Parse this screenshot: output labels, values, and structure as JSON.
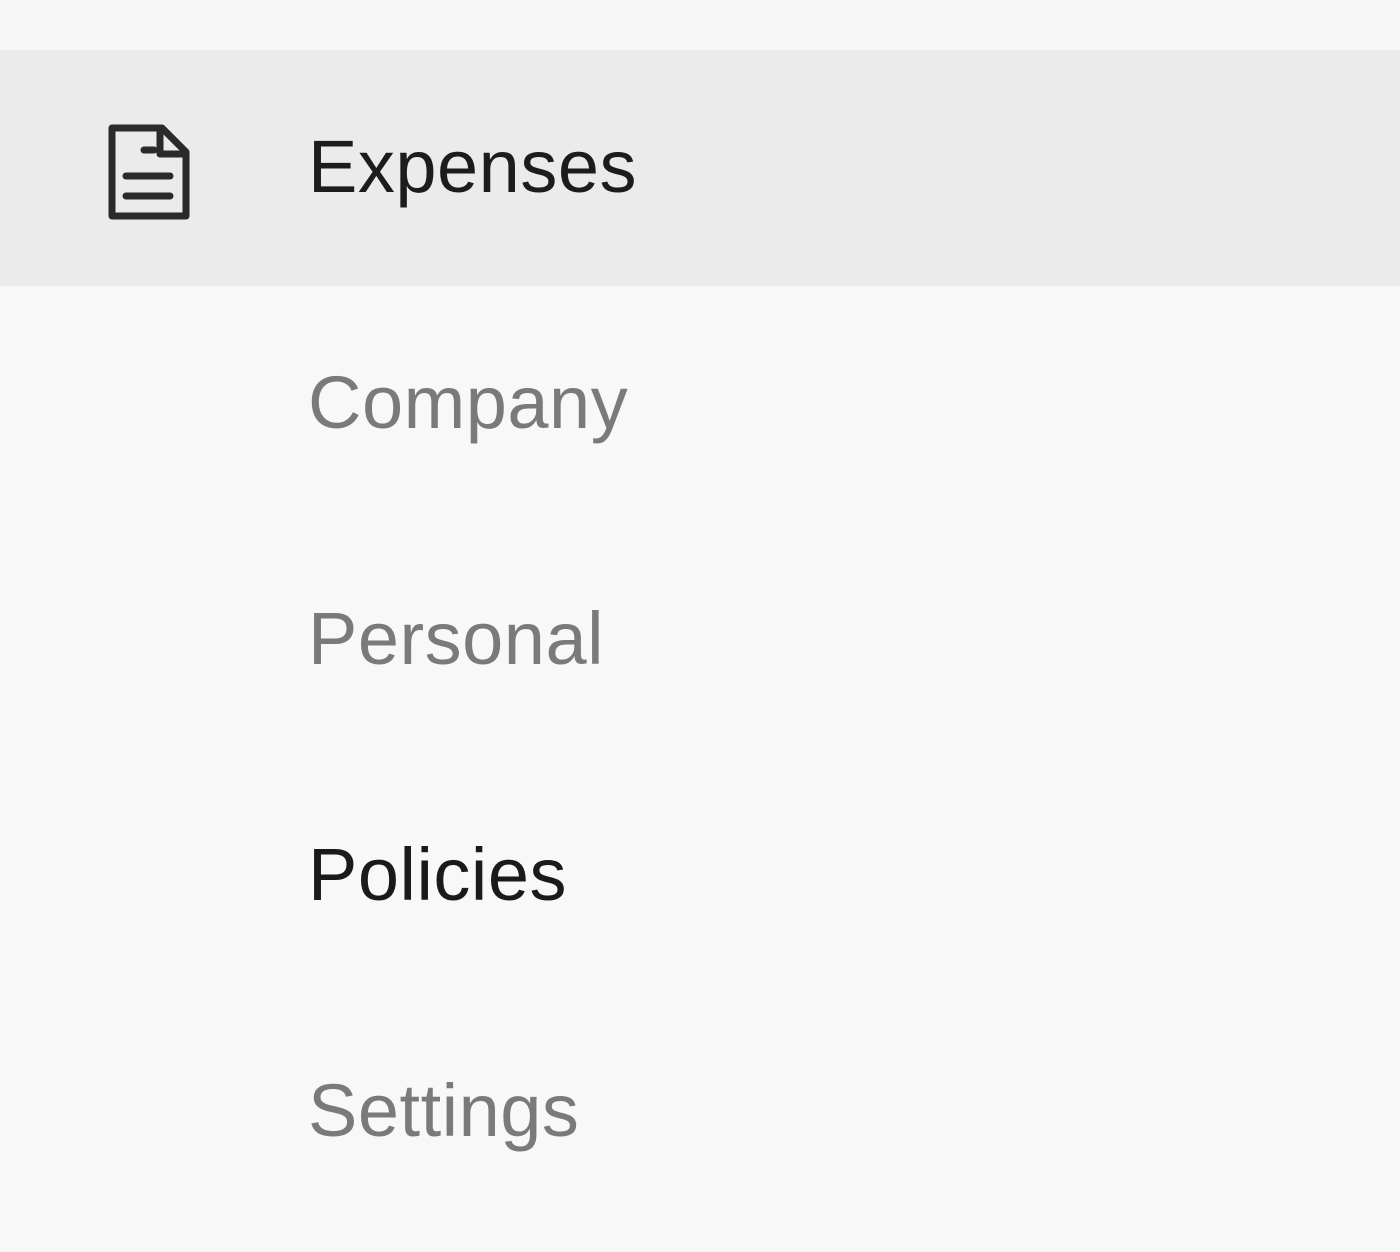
{
  "nav": {
    "primary": {
      "label": "Expenses",
      "icon": "document-icon"
    },
    "sub_items": [
      {
        "label": "Company",
        "state": "muted"
      },
      {
        "label": "Personal",
        "state": "muted"
      },
      {
        "label": "Policies",
        "state": "active"
      },
      {
        "label": "Settings",
        "state": "muted"
      }
    ]
  },
  "colors": {
    "background": "#f8f8f8",
    "selected_background": "#ebebeb",
    "text_active": "#1a1a1a",
    "text_muted": "#7a7a7a"
  }
}
